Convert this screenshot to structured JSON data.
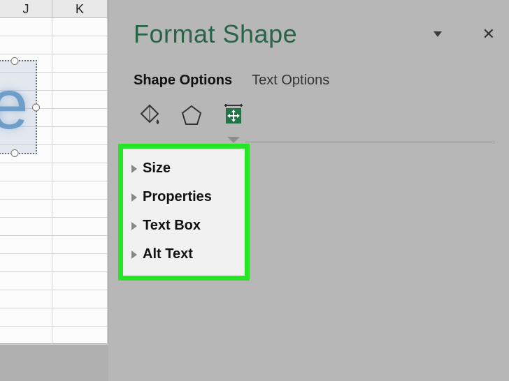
{
  "columns": {
    "j": "J",
    "k": "K"
  },
  "panel": {
    "title": "Format Shape",
    "tab_shape": "Shape Options",
    "tab_text": "Text Options"
  },
  "sections": {
    "size": "Size",
    "properties": "Properties",
    "textbox": "Text Box",
    "alttext": "Alt Text"
  }
}
